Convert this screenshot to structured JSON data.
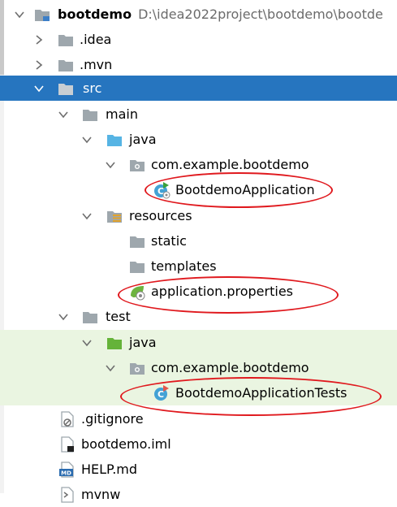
{
  "tree": {
    "root": {
      "label": "bootdemo",
      "path": "D:\\idea2022project\\bootdemo\\bootde"
    },
    "idea": "idea",
    "mvn": "mvn",
    "src": "src",
    "main": "main",
    "main_java": "java",
    "main_package": "com.example.bootdemo",
    "main_class": "BootdemoApplication",
    "resources": "resources",
    "static": "static",
    "templates": "templates",
    "properties": "application.properties",
    "test": "test",
    "test_java": "java",
    "test_package": "com.example.bootdemo",
    "test_class": "BootdemoApplicationTests",
    "gitignore": ".gitignore",
    "iml": "bootdemo.iml",
    "help": "HELP.md",
    "mvnw": "mvnw"
  },
  "colors": {
    "selection": "#2675bf",
    "test_background": "#eaf5e1",
    "annotation_red": "#e0191e",
    "folder": "#9ea7ad",
    "java_folder_blue": "#56b4e4",
    "java_folder_green": "#65b339"
  }
}
